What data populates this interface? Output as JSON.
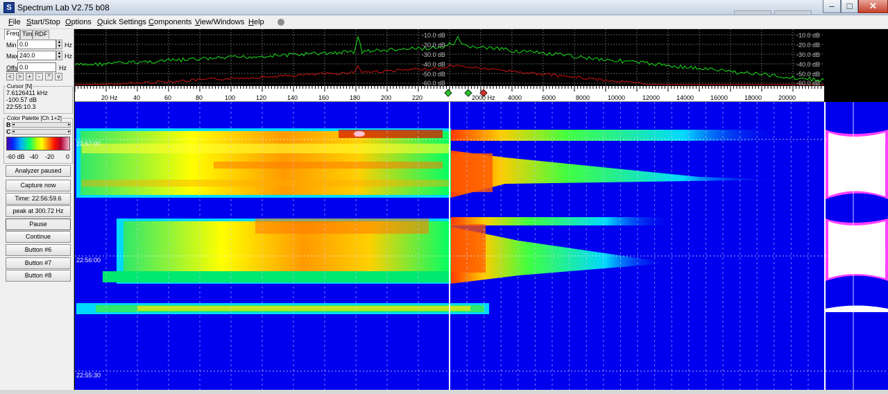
{
  "window": {
    "title": "Spectrum Lab V2.75 b08",
    "app_icon": "spectrum-app-icon",
    "minimize": "–",
    "maximize": "□",
    "close": "✕"
  },
  "menu": {
    "items": [
      "File",
      "Start/Stop",
      "Options",
      "Quick Settings",
      "Components",
      "View/Windows",
      "Help"
    ]
  },
  "freq_panel": {
    "tabs": [
      "Freq1",
      "Time",
      "RDF"
    ],
    "min_label": "Min",
    "min_value": "0.0",
    "min_unit": "Hz",
    "max_label": "Max",
    "max_value": "240.0",
    "max_unit": "Hz",
    "offs_label": "Offs",
    "offs_value": "0.0",
    "offs_unit": "Hz",
    "nav_buttons": [
      "<",
      ">",
      "+",
      "-",
      "^",
      "v"
    ]
  },
  "cursor": {
    "title": "Cursor [N]",
    "freq": "7.6126411 kHz",
    "level": "-100.57 dB",
    "time": "22:55:10.3"
  },
  "palette": {
    "title": "Color Palette [Ch 1+2]",
    "b_label": "B",
    "c_label": "C",
    "labels": [
      "-60 dB",
      "-40",
      "-20",
      "0"
    ]
  },
  "buttons": {
    "analyzer": "Analyzer paused",
    "capture": "Capture now",
    "time": "Time:  22:56:59.6",
    "peak": "peak at 300.72 Hz",
    "pause": "Pause",
    "continue": "Continue",
    "b6": "Button #6",
    "b7": "Button #7",
    "b8": "Button #8"
  },
  "spectrum": {
    "db_labels_mid": [
      "-10.0 dB",
      "-20.0 dB",
      "-30.0 dB",
      "-40.0 dB",
      "-50.0 dB",
      "-60.0 dB"
    ],
    "db_labels_right": [
      "-10.0 dB",
      "-20.0 dB",
      "-30.0 dB",
      "-40.0 dB",
      "-50.0 dB",
      "-60.0 dB"
    ],
    "trace_colors": {
      "channel1": "#19e019",
      "channel2": "#d01010"
    }
  },
  "freq_axis": {
    "left_ticks": [
      "20 Hz",
      "40",
      "60",
      "80",
      "100",
      "120",
      "140",
      "160",
      "180",
      "200",
      "220"
    ],
    "right_ticks": [
      "2000 Hz",
      "4000",
      "6000",
      "8000",
      "10000",
      "12000",
      "14000",
      "16000",
      "18000",
      "20000"
    ]
  },
  "waterfall": {
    "time_labels": [
      "22:57:00",
      "22:56:00",
      "22:55:30"
    ],
    "background": "#0000ee"
  }
}
